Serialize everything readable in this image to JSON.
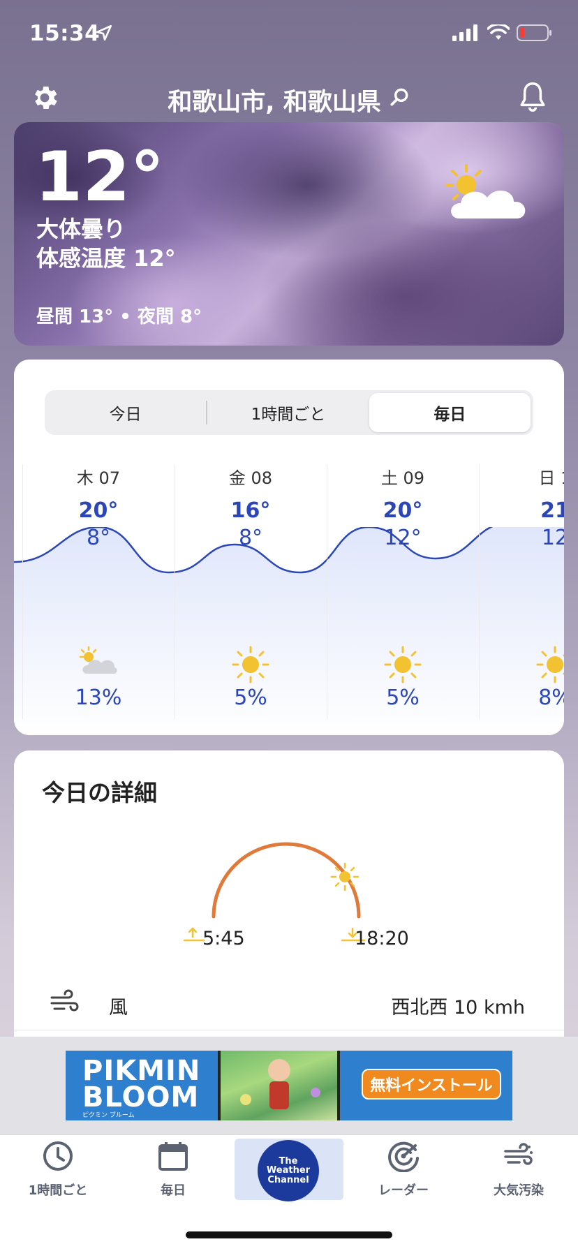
{
  "status_bar": {
    "time": "15:34",
    "icons": [
      "location-arrow-icon",
      "signal-icon",
      "wifi-icon",
      "battery-low-icon"
    ]
  },
  "header": {
    "location": "和歌山市, 和歌山県",
    "icons": [
      "gear-icon",
      "search-icon",
      "bell-icon"
    ]
  },
  "current": {
    "temperature": "12°",
    "condition": "大体曇り",
    "feels_like": "体感温度 12°",
    "day_night": "昼間 13° • 夜間 8°",
    "icon": "partly-cloudy-icon"
  },
  "forecast": {
    "tabs": [
      {
        "label": "今日",
        "active": false
      },
      {
        "label": "1時間ごと",
        "active": false
      },
      {
        "label": "毎日",
        "active": true
      }
    ],
    "days": [
      {
        "label": "木 07",
        "high": "20°",
        "low": "8°",
        "icon": "partly-cloudy-icon",
        "precip": "13%"
      },
      {
        "label": "金 08",
        "high": "16°",
        "low": "8°",
        "icon": "sun-icon",
        "precip": "5%"
      },
      {
        "label": "土 09",
        "high": "20°",
        "low": "12°",
        "icon": "sun-icon",
        "precip": "5%"
      },
      {
        "label": "日 1",
        "high": "21",
        "low": "12",
        "icon": "sun-icon",
        "precip": "8%"
      }
    ]
  },
  "details": {
    "title": "今日の詳細",
    "sunrise": "5:45",
    "sunset": "18:20",
    "wind_label": "風",
    "wind_value": "西北西 10 kmh"
  },
  "ad": {
    "logo": "PIKMIN BLOOM",
    "logo_sub": "ピクミン ブルーム",
    "cta": "無料インストール"
  },
  "tab_bar": {
    "hourly": "1時間ごと",
    "daily": "毎日",
    "brand": "The Weather Channel",
    "radar": "レーダー",
    "air": "大気汚染"
  },
  "colors": {
    "accent_blue": "#2a46b8",
    "sun_arc": "#e07a3a",
    "sun_yellow": "#f2c230"
  }
}
